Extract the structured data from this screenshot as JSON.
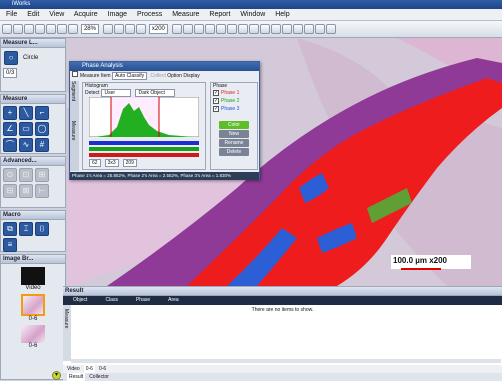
{
  "app": {
    "title": "iWorks"
  },
  "menu": [
    "File",
    "Edit",
    "View",
    "Acquire",
    "Image",
    "Process",
    "Measure",
    "Report",
    "Window",
    "Help"
  ],
  "toolbar": {
    "zoom": "28%",
    "size": "x200"
  },
  "panels": {
    "measure_top": {
      "title": "Measure L...",
      "shape": "Circle",
      "count": "0/3"
    },
    "measure": {
      "title": "Measure"
    },
    "advanced": {
      "title": "Advanced..."
    },
    "macro": {
      "title": "Macro"
    },
    "image_browser": {
      "title": "Image Br...",
      "items": [
        "Video",
        "0-6",
        "0-6"
      ]
    }
  },
  "dialog": {
    "title": "Phase Analysis",
    "measure_item": "Measure Item",
    "auto_classify": "Auto Classify",
    "collect": "Collect",
    "option": "Option",
    "display": "Display",
    "histogram_label": "Histogram",
    "detect_label": "Detect",
    "detect_value": "User",
    "object_value": "Dark Object",
    "phase_header": "Phase",
    "phases": [
      "Phase 1",
      "Phase 2",
      "Phase 3"
    ],
    "phase_colors": [
      "#e02020",
      "#18a018",
      "#2050d0"
    ],
    "low_value": "62",
    "kernel": "3x3",
    "high_value": "209",
    "color_btn": "Color",
    "new_btn": "New",
    "rename_btn": "Rename",
    "delete_btn": "Delete",
    "status": "Phase 1's Area = 25.852%, Phase 2's Area = 2.552%, Phase 3's Area = 1.830%",
    "side_tabs": [
      "Segment",
      "Measure"
    ]
  },
  "scale_bar": "100.0 µm x200",
  "result": {
    "title": "Result",
    "columns": [
      "Object",
      "Class",
      "Phase",
      "Area"
    ],
    "empty_message": "There are no items to show.",
    "side_tab": "Measure",
    "bottom_tabs_top": [
      "Video",
      "0-6",
      "0-6"
    ],
    "bottom_tabs": [
      "Result",
      "Collector"
    ]
  }
}
